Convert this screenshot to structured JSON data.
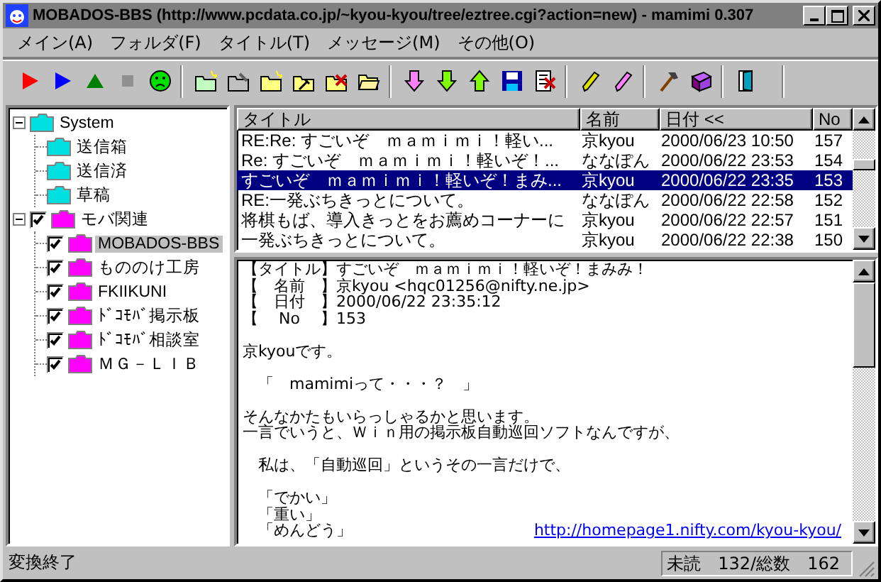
{
  "window": {
    "title": "MOBADOS-BBS (http://www.pcdata.co.jp/~kyou-kyou/tree/eztree.cgi?action=new) - mamimi 0.307"
  },
  "menu": [
    "メイン(A)",
    "フォルダ(F)",
    "タイトル(T)",
    "メッセージ(M)",
    "その他(O)"
  ],
  "tree": [
    {
      "label": "System",
      "kind": "plain",
      "color": "#00e0e0",
      "expanded": true,
      "selected": false,
      "children": [
        {
          "label": "送信箱",
          "kind": "plain",
          "color": "#00e0e0",
          "selected": false
        },
        {
          "label": "送信済",
          "kind": "plain",
          "color": "#00e0e0",
          "selected": false
        },
        {
          "label": "草稿",
          "kind": "plain",
          "color": "#00e0e0",
          "selected": false
        }
      ]
    },
    {
      "label": "モバ関連",
      "kind": "check",
      "checked": true,
      "color": "#ff00ff",
      "expanded": true,
      "selected": false,
      "children": [
        {
          "label": "MOBADOS-BBS",
          "kind": "check",
          "checked": true,
          "color": "#ff00ff",
          "selected": true
        },
        {
          "label": "もののけ工房",
          "kind": "check",
          "checked": true,
          "color": "#ff00ff",
          "selected": false
        },
        {
          "label": "FKIIKUNI",
          "kind": "check",
          "checked": true,
          "color": "#ff00ff",
          "selected": false
        },
        {
          "label": "ﾄﾞｺﾓﾊﾞ掲示板",
          "kind": "check",
          "checked": true,
          "color": "#ff00ff",
          "selected": false
        },
        {
          "label": "ﾄﾞｺﾓﾊﾞ相談室",
          "kind": "check",
          "checked": true,
          "color": "#ff00ff",
          "selected": false
        },
        {
          "label": "ＭＧ－ＬＩＢ",
          "kind": "check",
          "checked": true,
          "color": "#ff00ff",
          "selected": false
        }
      ]
    }
  ],
  "table": {
    "columns": [
      "タイトル",
      "名前",
      "日付 <<",
      "No"
    ],
    "rows": [
      {
        "cells": [
          "RE:Re: すごいぞ　ｍａｍｉｍｉ！軽い...",
          "京kyou",
          "2000/06/23 10:50",
          "157"
        ],
        "selected": false
      },
      {
        "cells": [
          "Re: すごいぞ　ｍａｍｉｍｉ！軽いぞ！...",
          "ななぽん",
          "2000/06/22 23:53",
          "154"
        ],
        "selected": false
      },
      {
        "cells": [
          "すごいぞ　ｍａｍｉｍｉ！軽いぞ！まみ...",
          "京kyou",
          "2000/06/22 23:35",
          "153"
        ],
        "selected": true
      },
      {
        "cells": [
          "RE:一発ぶちきっとについて。",
          "ななぽん",
          "2000/06/22 22:58",
          "152"
        ],
        "selected": false
      },
      {
        "cells": [
          "将棋もば、導入きっとをお薦めコーナーに",
          "京kyou",
          "2000/06/22 22:57",
          "151"
        ],
        "selected": false
      },
      {
        "cells": [
          "一発ぶちきっとについて。",
          "京kyou",
          "2000/06/22 22:38",
          "150"
        ],
        "selected": false
      }
    ]
  },
  "message": {
    "headers": [
      {
        "label": "【タイトル】",
        "value": "すごいぞ　ｍａｍｉｍｉ！軽いぞ！まみみ！"
      },
      {
        "label": "【　名前　】",
        "value": "京kyou <hqc01256@nifty.ne.jp>"
      },
      {
        "label": "【　日付　】",
        "value": "2000/06/22 23:35:12"
      },
      {
        "label": "【　 No 　】",
        "value": "153"
      }
    ],
    "paragraphs": [
      [
        "京kyouです。"
      ],
      [
        "　「　mamimiって・・・？　」"
      ],
      [
        "そんなかたもいらっしゃるかと思います。",
        "一言でいうと、Ｗｉｎ用の掲示板自動巡回ソフトなんですが、"
      ],
      [
        "　私は、「自動巡回」というその一言だけで、"
      ],
      [
        "　「でかい」",
        "　「重い」",
        "　「めんどう」"
      ]
    ],
    "link": "http://homepage1.nifty.com/kyou-kyou/"
  },
  "status_bar": {
    "message": "変換終了",
    "counts": "未読　132/総数　162"
  }
}
